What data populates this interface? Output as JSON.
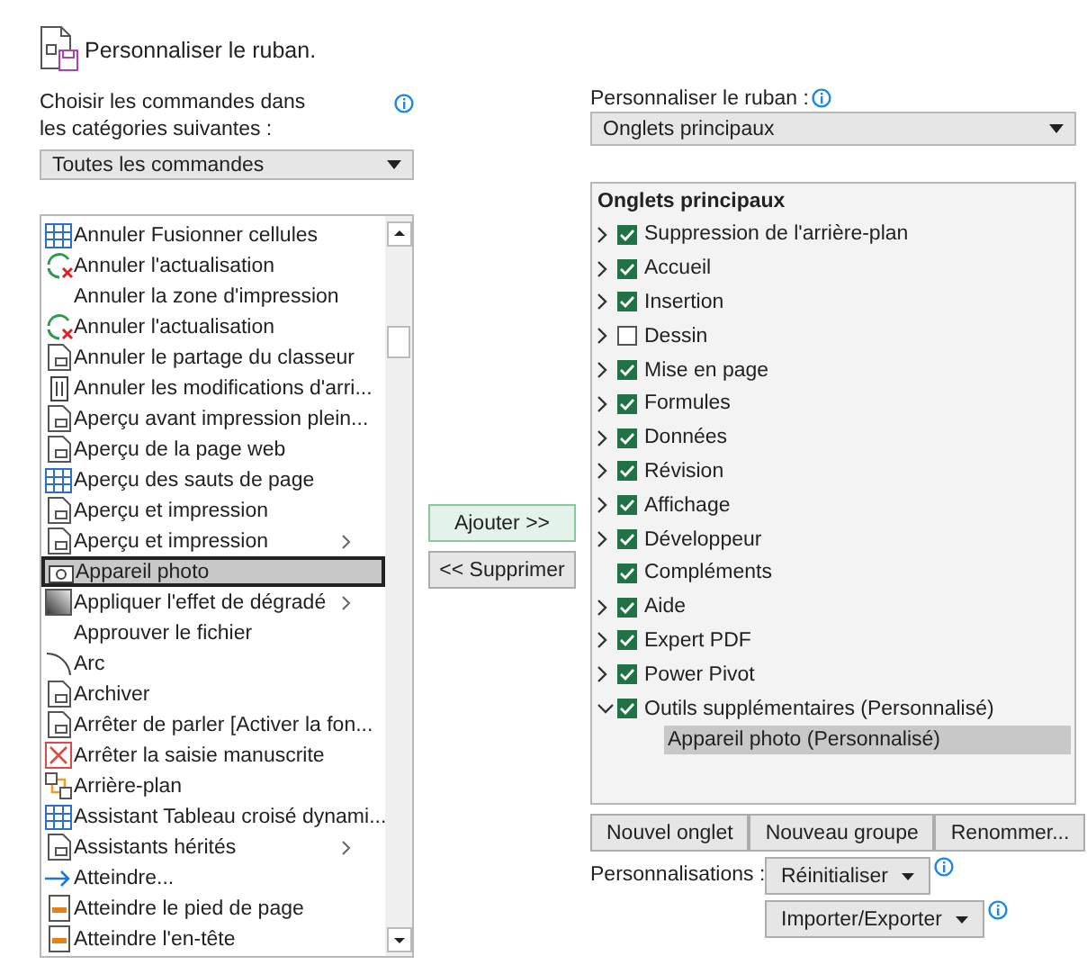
{
  "header": {
    "title": "Personnaliser le ruban."
  },
  "left": {
    "label": "Choisir les commandes dans les catégories suivantes :",
    "dropdown": "Toutes les commandes",
    "commands": [
      {
        "label": "Annuler Fusionner cellules",
        "submenu": false,
        "selected": false
      },
      {
        "label": "Annuler l'actualisation",
        "submenu": false,
        "selected": false
      },
      {
        "label": "Annuler la zone d'impression",
        "submenu": false,
        "selected": false
      },
      {
        "label": "Annuler l'actualisation",
        "submenu": false,
        "selected": false
      },
      {
        "label": "Annuler le partage du classeur",
        "submenu": false,
        "selected": false
      },
      {
        "label": "Annuler les modifications d'arri...",
        "submenu": false,
        "selected": false
      },
      {
        "label": "Aperçu avant impression plein...",
        "submenu": false,
        "selected": false
      },
      {
        "label": "Aperçu de la page web",
        "submenu": false,
        "selected": false
      },
      {
        "label": "Aperçu des sauts de page",
        "submenu": false,
        "selected": false
      },
      {
        "label": "Aperçu et impression",
        "submenu": false,
        "selected": false
      },
      {
        "label": "Aperçu et impression",
        "submenu": true,
        "selected": false
      },
      {
        "label": "Appareil photo",
        "submenu": false,
        "selected": true
      },
      {
        "label": "Appliquer l'effet de dégradé",
        "submenu": true,
        "selected": false
      },
      {
        "label": "Approuver le fichier",
        "submenu": false,
        "selected": false
      },
      {
        "label": "Arc",
        "submenu": false,
        "selected": false
      },
      {
        "label": "Archiver",
        "submenu": false,
        "selected": false
      },
      {
        "label": "Arrêter de parler [Activer la fon...",
        "submenu": false,
        "selected": false
      },
      {
        "label": "Arrêter la saisie manuscrite",
        "submenu": false,
        "selected": false
      },
      {
        "label": "Arrière-plan",
        "submenu": false,
        "selected": false
      },
      {
        "label": "Assistant Tableau croisé dynami...",
        "submenu": false,
        "selected": false
      },
      {
        "label": "Assistants hérités",
        "submenu": true,
        "selected": false
      },
      {
        "label": "Atteindre...",
        "submenu": false,
        "selected": false
      },
      {
        "label": "Atteindre le pied de page",
        "submenu": false,
        "selected": false
      },
      {
        "label": "Atteindre l'en-tête",
        "submenu": false,
        "selected": false
      }
    ]
  },
  "middle": {
    "add_button": "Ajouter >>",
    "remove_button": "<< Supprimer"
  },
  "right": {
    "label": "Personnaliser le ruban :",
    "dropdown": "Onglets principaux",
    "tree": {
      "label": "Onglets principaux",
      "children": [
        {
          "label": "Suppression de l'arrière-plan",
          "expandable": true,
          "expanded": false,
          "checked": true
        },
        {
          "label": "Accueil",
          "expandable": true,
          "expanded": false,
          "checked": true
        },
        {
          "label": "Insertion",
          "expandable": true,
          "expanded": false,
          "checked": true
        },
        {
          "label": "Dessin",
          "expandable": true,
          "expanded": false,
          "checked": false
        },
        {
          "label": "Mise en page",
          "expandable": true,
          "expanded": false,
          "checked": true
        },
        {
          "label": "Formules",
          "expandable": true,
          "expanded": false,
          "checked": true
        },
        {
          "label": "Données",
          "expandable": true,
          "expanded": false,
          "checked": true
        },
        {
          "label": "Révision",
          "expandable": true,
          "expanded": false,
          "checked": true
        },
        {
          "label": "Affichage",
          "expandable": true,
          "expanded": false,
          "checked": true
        },
        {
          "label": "Développeur",
          "expandable": true,
          "expanded": false,
          "checked": true
        },
        {
          "label": "Compléments",
          "expandable": false,
          "expanded": false,
          "checked": true
        },
        {
          "label": "Aide",
          "expandable": true,
          "expanded": false,
          "checked": true
        },
        {
          "label": "Expert PDF",
          "expandable": true,
          "expanded": false,
          "checked": true
        },
        {
          "label": "Power Pivot",
          "expandable": true,
          "expanded": false,
          "checked": true
        },
        {
          "label": "Outils supplémentaires (Personnalisé)",
          "expandable": true,
          "expanded": true,
          "checked": true,
          "children": [
            {
              "label": "Appareil photo (Personnalisé)",
              "selected": true
            }
          ]
        }
      ]
    },
    "buttons": [
      "Nouvel onglet",
      "Nouveau groupe",
      "Renommer..."
    ],
    "customizations_label": "Personnalisations :",
    "reset_button": "Réinitialiser",
    "import_export_button": "Importer/Exporter"
  }
}
